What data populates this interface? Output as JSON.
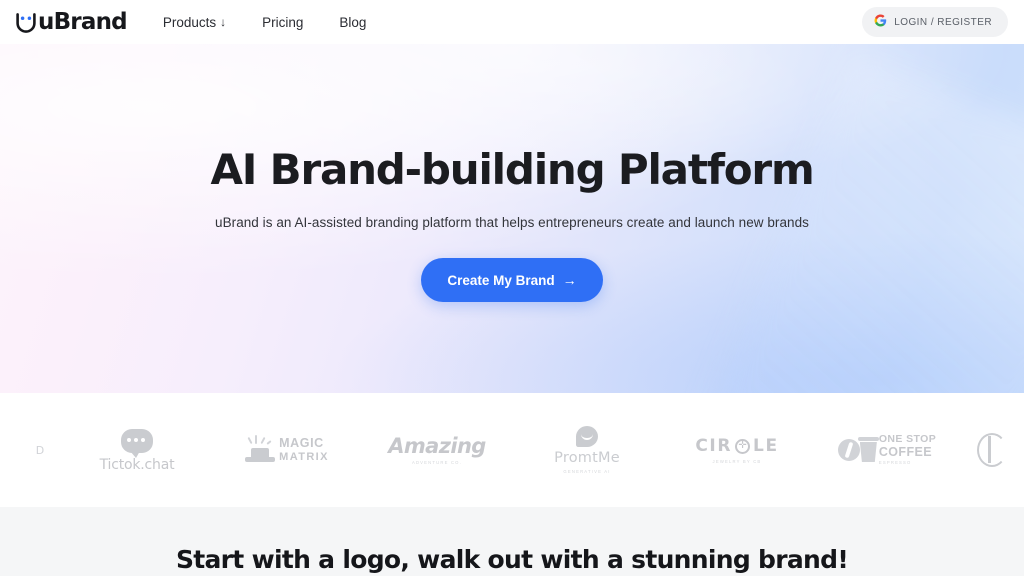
{
  "brand": {
    "name": "uBrand",
    "logo_icon": "ubrand-smiley-u-icon",
    "accent_color": "#2f6ff5",
    "eye_color": "#2f6ff5"
  },
  "navbar": {
    "links": [
      {
        "label": "Products",
        "caret": "↓",
        "has_dropdown": true
      },
      {
        "label": "Pricing",
        "caret": "",
        "has_dropdown": false
      },
      {
        "label": "Blog",
        "caret": "",
        "has_dropdown": false
      }
    ],
    "login": {
      "label": "LOGIN / REGISTER",
      "icon": "google-g-icon"
    }
  },
  "hero": {
    "title": "AI Brand-building Platform",
    "subtitle": "uBrand is an AI-assisted branding platform that helps entrepreneurs create and launch new brands",
    "cta": {
      "label": "Create My Brand",
      "arrow": "→"
    },
    "background_colors": {
      "left": "#fdf3fb",
      "mid": "#e4e6fb",
      "right": "#c9dcfb"
    }
  },
  "client_logos": {
    "items": [
      {
        "id": "edge-left",
        "name": "D",
        "tagline": "",
        "icon": "partial-logo-icon"
      },
      {
        "id": "tictok",
        "name": "Tictok.chat",
        "tagline": "",
        "icon": "speech-bubble-icon"
      },
      {
        "id": "magic-matrix",
        "name": "MAGIC",
        "name2": "MATRIX",
        "tagline": "",
        "icon": "magic-hat-icon"
      },
      {
        "id": "amazing",
        "name": "Amazing",
        "tagline": "Adventure Co.",
        "icon": "mountain-a-icon"
      },
      {
        "id": "promtme",
        "name": "PromtMe",
        "tagline": "Generative AI",
        "icon": "smile-bubble-icon"
      },
      {
        "id": "circle",
        "name_a": "CIR",
        "name_b": "LE",
        "tagline": "Jewelry by CB",
        "icon": "circle-plus-icon"
      },
      {
        "id": "one-stop-coffee",
        "name": "ONE STOP",
        "name2": "COFFEE",
        "tagline": "Espresso",
        "icon": "coffee-cup-bean-icon"
      },
      {
        "id": "edge-right",
        "name": "",
        "tagline": "",
        "icon": "partial-circle-logo-icon"
      }
    ]
  },
  "next_section": {
    "heading": "Start with a logo, walk out with a stunning brand!",
    "background_color": "#f5f6f7"
  }
}
